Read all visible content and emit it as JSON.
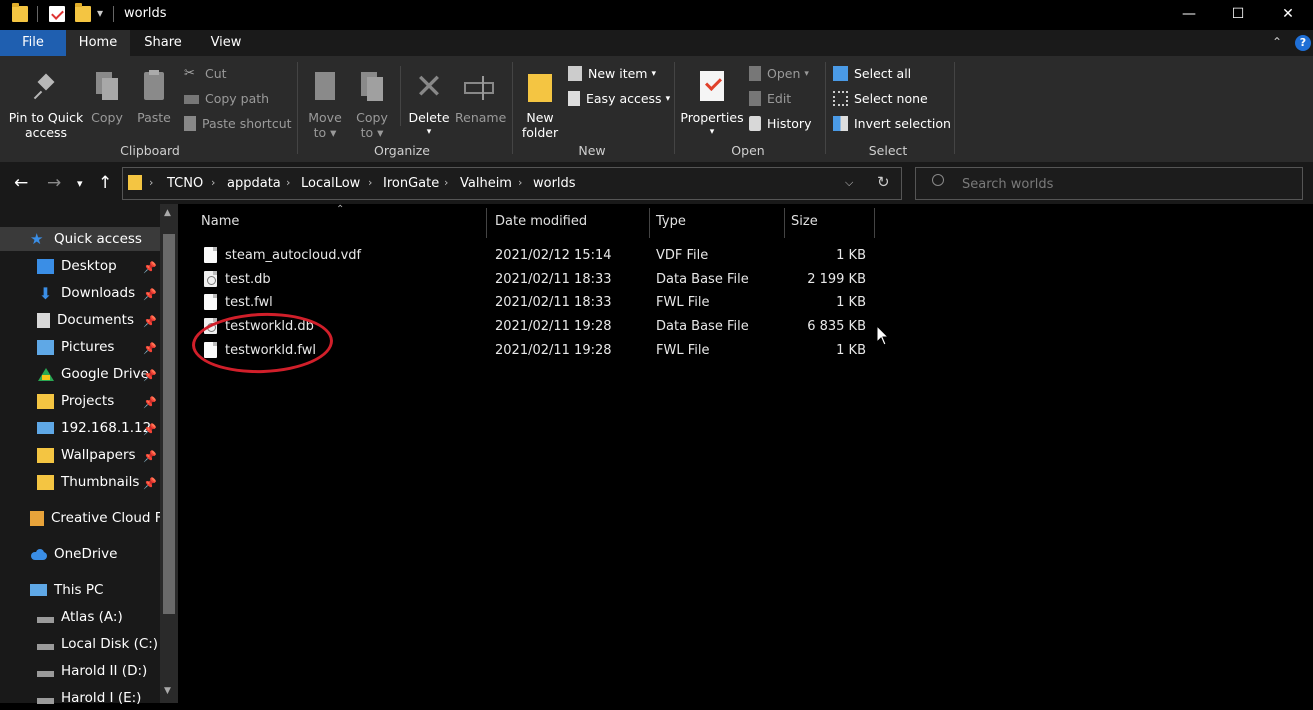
{
  "window": {
    "title": "worlds",
    "minimize": "—",
    "maximize": "☐",
    "close": "✕"
  },
  "tabs": [
    {
      "label": "File"
    },
    {
      "label": "Home"
    },
    {
      "label": "Share"
    },
    {
      "label": "View"
    }
  ],
  "ribbon": {
    "clipboard": {
      "pin_label_1": "Pin to Quick",
      "pin_label_2": "access",
      "copy": "Copy",
      "paste": "Paste",
      "cut": "Cut",
      "copy_path": "Copy path",
      "paste_shortcut": "Paste shortcut",
      "group": "Clipboard"
    },
    "organize": {
      "move_1": "Move",
      "move_2": "to",
      "copy_1": "Copy",
      "copy_2": "to",
      "delete": "Delete",
      "rename": "Rename",
      "group": "Organize"
    },
    "new": {
      "folder_1": "New",
      "folder_2": "folder",
      "new_item": "New item",
      "easy_access": "Easy access",
      "group": "New"
    },
    "open": {
      "properties": "Properties",
      "open": "Open",
      "edit": "Edit",
      "history": "History",
      "group": "Open"
    },
    "select": {
      "select_all": "Select all",
      "select_none": "Select none",
      "invert": "Invert selection",
      "group": "Select"
    }
  },
  "address": {
    "crumbs": [
      "TCNO",
      "appdata",
      "LocalLow",
      "IronGate",
      "Valheim",
      "worlds"
    ]
  },
  "search": {
    "placeholder": "Search worlds"
  },
  "nav": {
    "items": [
      {
        "label": "Quick access"
      },
      {
        "label": "Desktop"
      },
      {
        "label": "Downloads"
      },
      {
        "label": "Documents"
      },
      {
        "label": "Pictures"
      },
      {
        "label": "Google Drive"
      },
      {
        "label": "Projects"
      },
      {
        "label": "192.168.1.12"
      },
      {
        "label": "Wallpapers"
      },
      {
        "label": "Thumbnails"
      },
      {
        "label": "Creative Cloud Fil"
      },
      {
        "label": "OneDrive"
      },
      {
        "label": "This PC"
      },
      {
        "label": "Atlas (A:)"
      },
      {
        "label": "Local Disk (C:)"
      },
      {
        "label": "Harold II (D:)"
      },
      {
        "label": "Harold I (E:)"
      }
    ]
  },
  "columns": {
    "name": "Name",
    "date": "Date modified",
    "type": "Type",
    "size": "Size"
  },
  "files": [
    {
      "name": "steam_autocloud.vdf",
      "date": "2021/02/12 15:14",
      "type": "VDF File",
      "size": "1 KB"
    },
    {
      "name": "test.db",
      "date": "2021/02/11 18:33",
      "type": "Data Base File",
      "size": "2 199 KB"
    },
    {
      "name": "test.fwl",
      "date": "2021/02/11 18:33",
      "type": "FWL File",
      "size": "1 KB"
    },
    {
      "name": "testworkld.db",
      "date": "2021/02/11 19:28",
      "type": "Data Base File",
      "size": "6 835 KB"
    },
    {
      "name": "testworkld.fwl",
      "date": "2021/02/11 19:28",
      "type": "FWL File",
      "size": "1 KB"
    }
  ],
  "colors": {
    "file_tab": "#1f5fb0",
    "folder": "#f4c542",
    "annotation": "#d11f2a"
  }
}
